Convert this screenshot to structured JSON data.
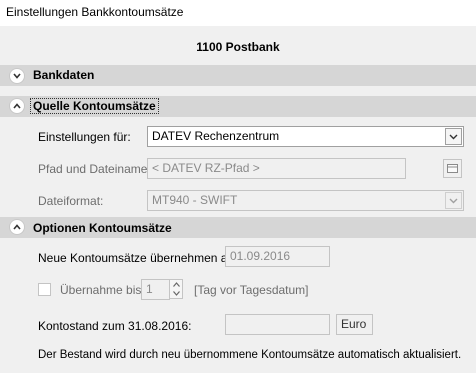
{
  "window": {
    "title": "Einstellungen Bankkontoumsätze"
  },
  "bank_header": "1100 Postbank",
  "sections": {
    "bankdaten": {
      "label": "Bankdaten",
      "state": "collapsed"
    },
    "quelle": {
      "label": "Quelle Kontoumsätze",
      "state": "expanded"
    },
    "optionen": {
      "label": "Optionen Kontoumsätze",
      "state": "expanded"
    }
  },
  "quelle": {
    "einstellungen_label": "Einstellungen für:",
    "einstellungen_value": "DATEV Rechenzentrum",
    "pfad_label": "Pfad und Dateiname:",
    "pfad_placeholder": "< DATEV RZ-Pfad >",
    "dateiformat_label": "Dateiformat:",
    "dateiformat_value": "MT940  - SWIFT"
  },
  "optionen": {
    "neue_label": "Neue Kontoumsätze übernehmen ab:",
    "neue_value": "01.09.2016",
    "uebernahme_label": "Übernahme bis",
    "uebernahme_value": "1",
    "uebernahme_hint": "[Tag vor Tagesdatum]",
    "kontostand_label": "Kontostand zum 31.08.2016:",
    "kontostand_value": "",
    "currency": "Euro",
    "info_text": "Der Bestand wird durch neu übernommene Kontoumsätze automatisch aktualisiert."
  },
  "icons": {
    "expand": "chevron-down-icon",
    "collapse": "chevron-up-icon",
    "browse": "folder-icon",
    "dropdown": "dropdown-arrow-icon",
    "spin_up": "spin-up-icon",
    "spin_down": "spin-down-icon"
  }
}
